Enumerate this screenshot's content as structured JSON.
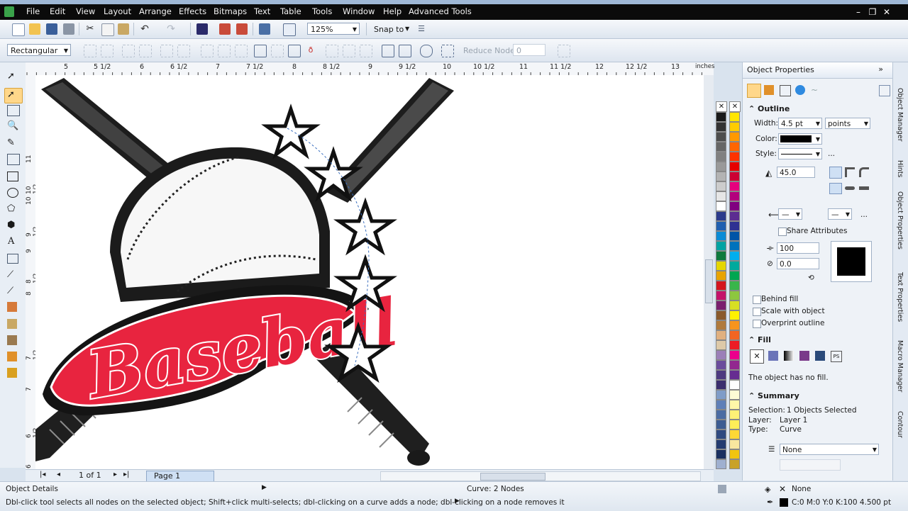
{
  "menu": {
    "items": [
      "File",
      "Edit",
      "View",
      "Layout",
      "Arrange",
      "Effects",
      "Bitmaps",
      "Text",
      "Table",
      "Tools",
      "Window",
      "Help",
      "Advanced Tools"
    ]
  },
  "toolbar": {
    "zoom_value": "125%",
    "snap_label": "Snap to",
    "shape_mode": "Rectangular",
    "reduce_nodes_label": "Reduce Nodes",
    "reduce_nodes_value": "0"
  },
  "ruler": {
    "top_labels": [
      "5",
      "5 1/2",
      "6",
      "6 1/2",
      "7",
      "7 1/2",
      "8",
      "8 1/2",
      "9",
      "9 1/2",
      "10",
      "10 1/2",
      "11",
      "11 1/2",
      "12",
      "12 1/2",
      "13"
    ],
    "units": "inches",
    "left_labels": [
      "11",
      "10 1/2",
      "10",
      "9 1/2",
      "9",
      "8 1/2",
      "8",
      "7 1/2",
      "7",
      "6 1/2",
      "6"
    ]
  },
  "document": {
    "logo_text": "Baseball",
    "page_count": "1 of 1",
    "page_tab": "Page 1"
  },
  "palette": {
    "col1": [
      "#1a1a1a",
      "#333333",
      "#4d4d4d",
      "#666666",
      "#808080",
      "#999999",
      "#b3b3b3",
      "#cccccc",
      "#e6e6e6",
      "#ffffff",
      "#2b3a8c",
      "#1f5fb0",
      "#0a8bd6",
      "#00a3a3",
      "#0f7a3d",
      "#e5d600",
      "#e8a300",
      "#d4141e",
      "#c4126b",
      "#7a1f6e",
      "#8a5a2b",
      "#b07a3c",
      "#e0b080",
      "#ddc9a8",
      "#9b7fb8",
      "#6a4c9c",
      "#4d3a80",
      "#3a2e6e",
      "#7f9cc8",
      "#5f7fb8",
      "#4b6ca3",
      "#3c5c92",
      "#2f4a80",
      "#233b70",
      "#1a3060",
      "#9fb0d0"
    ],
    "col2": [
      "#ffe600",
      "#ffcc00",
      "#ff9900",
      "#ff6600",
      "#ff3300",
      "#e60000",
      "#cc0033",
      "#e6007e",
      "#b3007d",
      "#800080",
      "#5c2d91",
      "#2e3192",
      "#0054a6",
      "#0072bc",
      "#00aeef",
      "#00a99d",
      "#00a651",
      "#39b54a",
      "#8dc63f",
      "#d7df23",
      "#fff200",
      "#f7941d",
      "#f26522",
      "#ed1c24",
      "#ec008c",
      "#92278f",
      "#662d91",
      "#ffffff",
      "#fdfbd5",
      "#fff7a8",
      "#fff176",
      "#ffee58",
      "#fdd835",
      "#f9e79f",
      "#f1c40f",
      "#c9a227"
    ]
  },
  "panel": {
    "title": "Object Properties",
    "outline": {
      "header": "Outline",
      "width_label": "Width:",
      "width_value": "4.5 pt",
      "units_value": "points",
      "color_label": "Color:",
      "color": "#000000",
      "style_label": "Style:",
      "miter_value": "45.0",
      "share_label": "Share Attributes",
      "stretch_value": "100",
      "angle_value": "0.0",
      "behind_fill": "Behind fill",
      "scale_with": "Scale with object",
      "overprint": "Overprint outline"
    },
    "fill": {
      "header": "Fill",
      "no_fill_text": "The object has no fill."
    },
    "summary": {
      "header": "Summary",
      "selection_label": "Selection:",
      "selection_value": "1 Objects Selected",
      "layer_label": "Layer:",
      "layer_value": "Layer 1",
      "type_label": "Type:",
      "type_value": "Curve",
      "wrap_value": "None"
    }
  },
  "docker_tabs": [
    "Object Manager",
    "Hints",
    "Object Properties",
    "Text Properties",
    "Macro Manager",
    "Contour"
  ],
  "status": {
    "object_details": "Object Details",
    "curve_info": "Curve: 2 Nodes",
    "fill_label": "None",
    "hint": "Dbl-click tool selects all nodes on the selected object; Shift+click multi-selects; dbl-clicking on a curve adds a node; dbl-clicking on a node removes it",
    "outline_info": "C:0 M:0 Y:0 K:100  4.500 pt"
  },
  "colors": {
    "accent_red": "#e8243f",
    "dark": "#222222",
    "selection_highlight": "#ffd78a"
  }
}
